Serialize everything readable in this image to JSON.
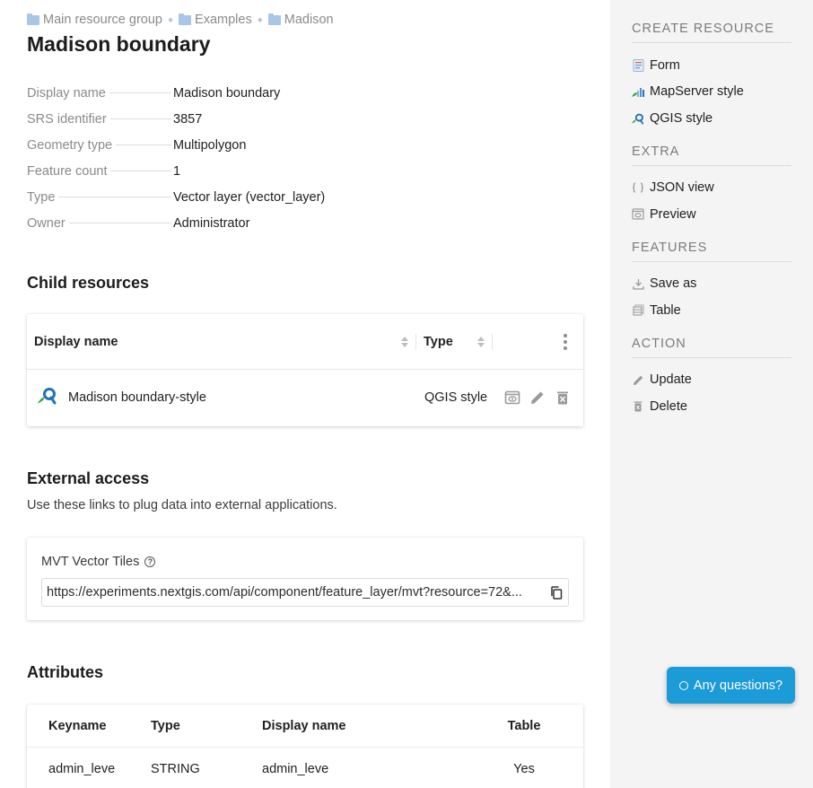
{
  "breadcrumb": [
    "Main resource group",
    "Examples",
    "Madison"
  ],
  "title": "Madison boundary",
  "properties": [
    {
      "key": "Display name",
      "value": "Madison boundary"
    },
    {
      "key": "SRS identifier",
      "value": "3857"
    },
    {
      "key": "Geometry type",
      "value": "Multipolygon"
    },
    {
      "key": "Feature count",
      "value": "1"
    },
    {
      "key": "Type",
      "value": "Vector layer (vector_layer)"
    },
    {
      "key": "Owner",
      "value": "Administrator"
    }
  ],
  "child_resources": {
    "heading": "Child resources",
    "columns": {
      "name": "Display name",
      "type": "Type"
    },
    "rows": [
      {
        "name": "Madison boundary-style",
        "type": "QGIS style"
      }
    ]
  },
  "external_access": {
    "heading": "External access",
    "description": "Use these links to plug data into external applications.",
    "mvt_label": "MVT Vector Tiles",
    "help_glyph": "?",
    "mvt_url": "https://experiments.nextgis.com/api/component/feature_layer/mvt?resource=72&..."
  },
  "attributes": {
    "heading": "Attributes",
    "columns": {
      "keyname": "Keyname",
      "type": "Type",
      "display_name": "Display name",
      "table": "Table"
    },
    "rows": [
      {
        "keyname": "admin_leve",
        "type": "STRING",
        "display_name": "admin_leve",
        "table": "Yes"
      }
    ]
  },
  "sidebar": {
    "create": {
      "title": "Create resource",
      "items": [
        "Form",
        "MapServer style",
        "QGIS style"
      ]
    },
    "extra": {
      "title": "Extra",
      "items": [
        "JSON view",
        "Preview"
      ]
    },
    "features": {
      "title": "Features",
      "items": [
        "Save as",
        "Table"
      ]
    },
    "action": {
      "title": "Action",
      "items": [
        "Update",
        "Delete"
      ]
    }
  },
  "help_button": {
    "label": "Any questions?"
  },
  "colors": {
    "accent": "#1b9bd8",
    "folder": "#a9c6e6",
    "sidebar_bg": "#f4f4f4"
  }
}
